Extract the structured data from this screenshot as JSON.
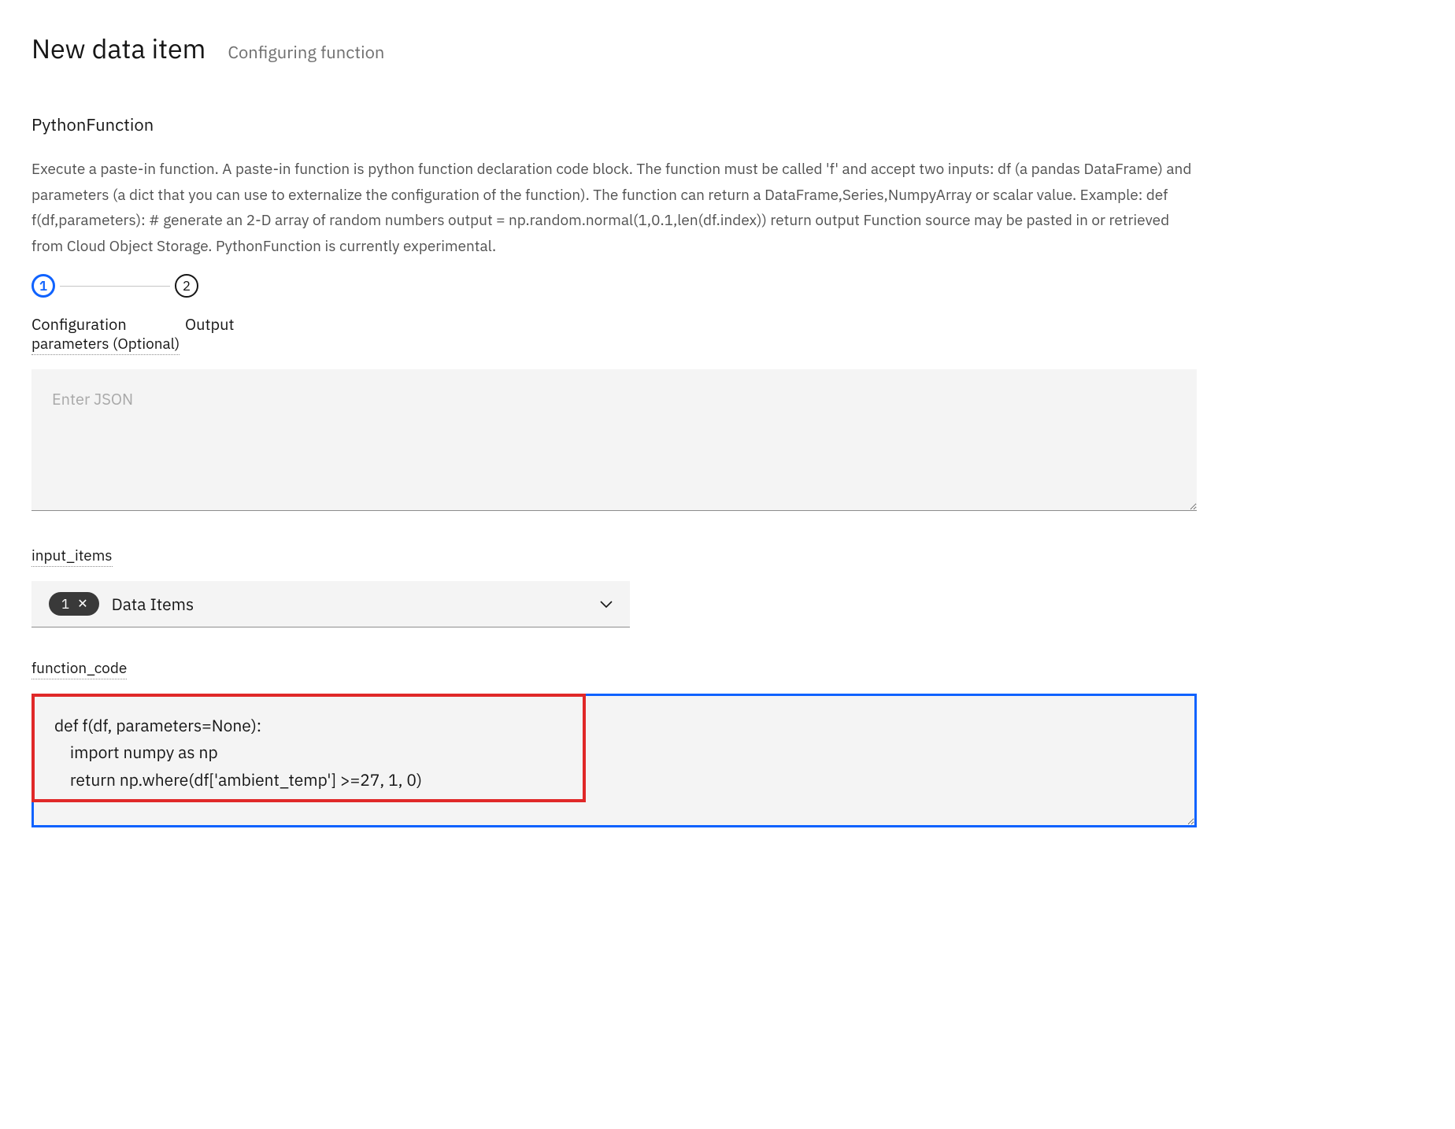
{
  "header": {
    "title": "New data item",
    "subtitle": "Configuring function"
  },
  "function": {
    "name": "PythonFunction",
    "description": "Execute a paste-in function. A paste-in function is python function declaration code block. The function must be called 'f' and accept two inputs: df (a pandas DataFrame) and parameters (a dict that you can use to externalize the configuration of the function). The function can return a DataFrame,Series,NumpyArray or scalar value. Example: def f(df,parameters): # generate an 2-D array of random numbers output = np.random.normal(1,0.1,len(df.index)) return output Function source may be pasted in or retrieved from Cloud Object Storage. PythonFunction is currently experimental."
  },
  "stepper": {
    "steps": [
      {
        "num": "1",
        "label": "Configuration"
      },
      {
        "num": "2",
        "label": "Output"
      }
    ]
  },
  "fields": {
    "parameters": {
      "label": "parameters (Optional)",
      "placeholder": "Enter JSON",
      "value": ""
    },
    "input_items": {
      "label": "input_items",
      "chip_count": "1",
      "text": "Data Items"
    },
    "function_code": {
      "label": "function_code",
      "value": "def f(df, parameters=None):\n    import numpy as np\n    return np.where(df['ambient_temp'] >=27, 1, 0)"
    }
  }
}
